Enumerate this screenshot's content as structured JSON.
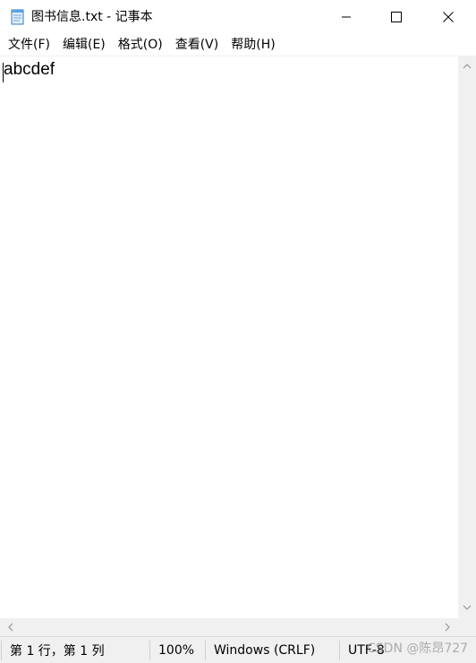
{
  "window": {
    "title": "图书信息.txt - 记事本"
  },
  "menu": {
    "items": [
      "文件(F)",
      "编辑(E)",
      "格式(O)",
      "查看(V)",
      "帮助(H)"
    ]
  },
  "editor": {
    "content": "abcdef"
  },
  "status": {
    "position": "第 1 行，第 1 列",
    "zoom": "100%",
    "line_ending": "Windows (CRLF)",
    "encoding": "UTF-8"
  },
  "watermark": "CSDN @陈昂727",
  "icons": {
    "app": "notepad-icon",
    "minimize": "minimize-icon",
    "maximize": "maximize-icon",
    "close": "close-icon"
  }
}
